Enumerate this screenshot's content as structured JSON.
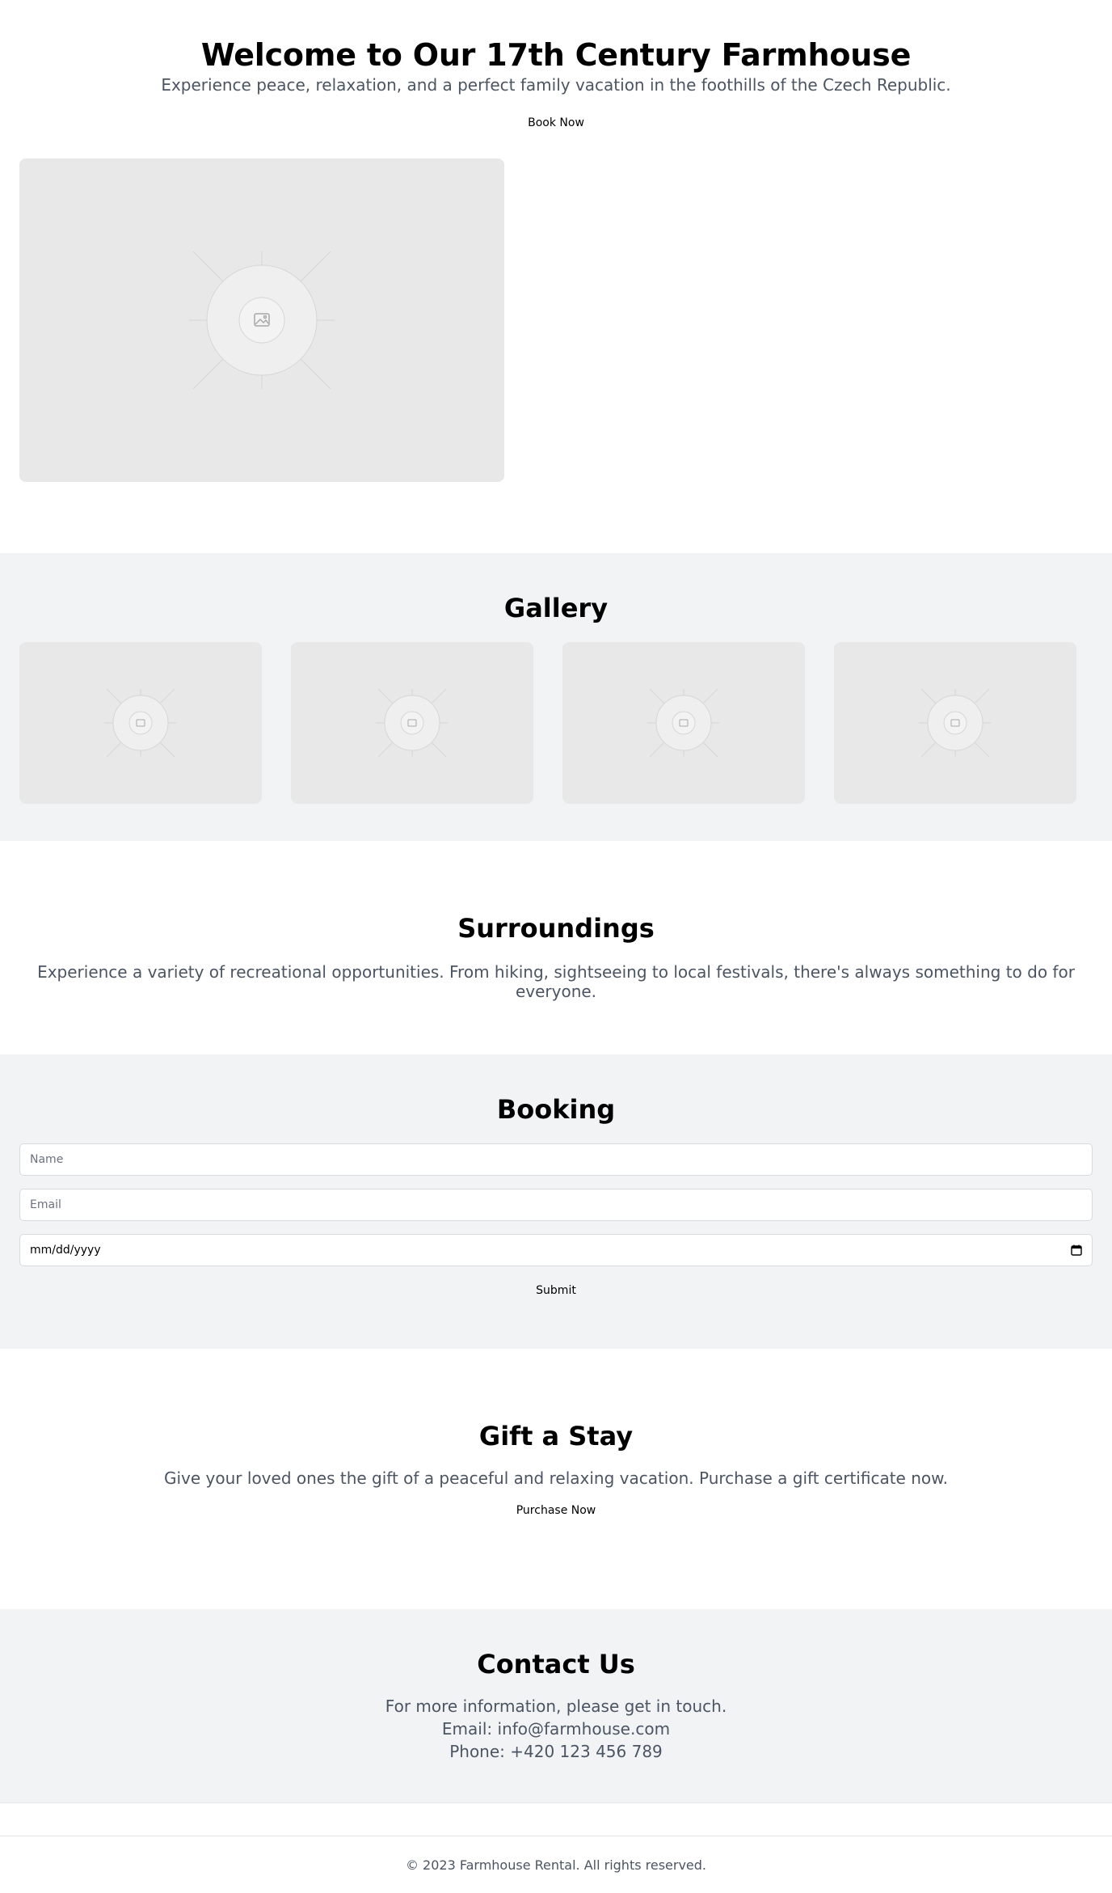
{
  "hero": {
    "title": "Welcome to Our 17th Century Farmhouse",
    "subtitle": "Experience peace, relaxation, and a perfect family vacation in the foothills of the Czech Republic.",
    "book_button": "Book Now",
    "image_icon": "image-placeholder-icon"
  },
  "gallery": {
    "title": "Gallery",
    "images": [
      "image-placeholder-icon",
      "image-placeholder-icon",
      "image-placeholder-icon",
      "image-placeholder-icon"
    ]
  },
  "surroundings": {
    "title": "Surroundings",
    "text": "Experience a variety of recreational opportunities. From hiking, sightseeing to local festivals, there's always something to do for everyone."
  },
  "booking": {
    "title": "Booking",
    "name_placeholder": "Name",
    "email_placeholder": "Email",
    "date_value": "mm/dd/yyyy",
    "calendar_icon": "calendar-icon",
    "submit_button": "Submit"
  },
  "gift": {
    "title": "Gift a Stay",
    "text": "Give your loved ones the gift of a peaceful and relaxing vacation. Purchase a gift certificate now.",
    "purchase_button": "Purchase Now"
  },
  "contact": {
    "title": "Contact Us",
    "line1": "For more information, please get in touch.",
    "email_line": "Email: info@farmhouse.com",
    "phone_line": "Phone: +420 123 456 789"
  },
  "footer": {
    "copyright": "© 2023 Farmhouse Rental. All rights reserved."
  },
  "colors": {
    "section_gray": "#f2f3f5",
    "placeholder": "#e8e8e8",
    "muted_text": "#4b5563"
  }
}
